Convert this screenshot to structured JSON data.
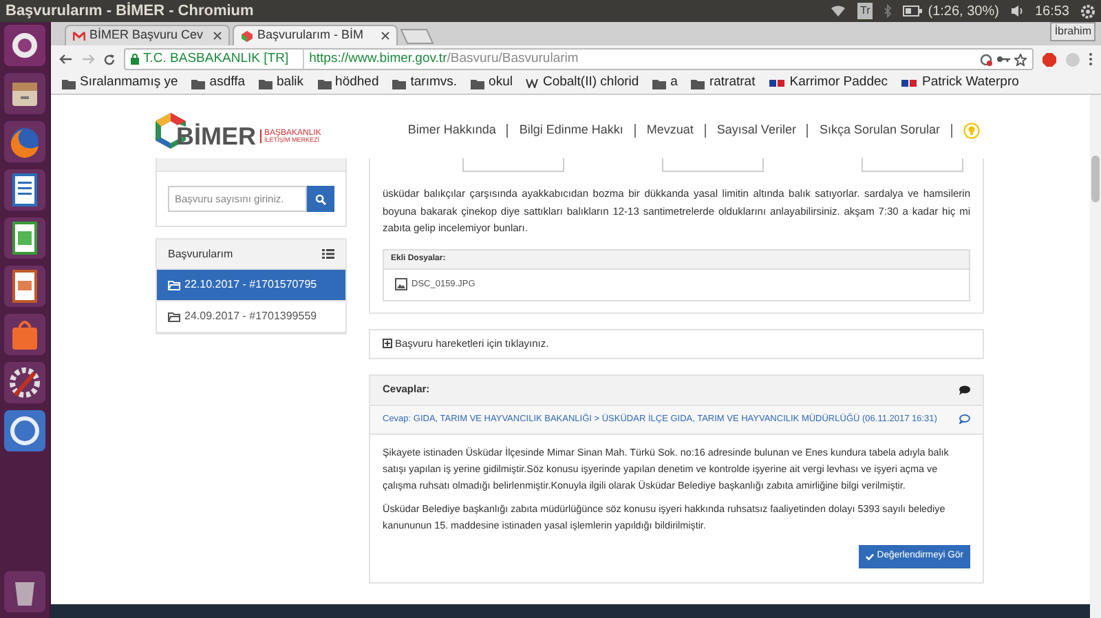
{
  "topbar": {
    "title": "Başvurularım - BİMER - Chromium",
    "keyboard": "Tr",
    "battery": "(1:26, 30%)",
    "clock": "16:53"
  },
  "tabs": [
    {
      "label": "BİMER Başvuru Cev",
      "selected": false,
      "kind": "mail"
    },
    {
      "label": "Başvurularım - BİM",
      "selected": true,
      "kind": "site"
    }
  ],
  "profile": "İbrahim",
  "address": {
    "security": "T.C. BASBAKANLIK [TR]",
    "host": "https://www.bimer.gov.tr",
    "path": "/Basvuru/Basvurularim"
  },
  "bookmarks": [
    {
      "label": "Sıralanmamış ye",
      "kind": "folder"
    },
    {
      "label": "asdffa",
      "kind": "folder"
    },
    {
      "label": "balik",
      "kind": "folder"
    },
    {
      "label": "hödhed",
      "kind": "folder"
    },
    {
      "label": "tarımvs.",
      "kind": "folder"
    },
    {
      "label": "okul",
      "kind": "folder"
    },
    {
      "label": "Cobalt(II) chlorid",
      "kind": "wiki"
    },
    {
      "label": "a",
      "kind": "folder"
    },
    {
      "label": "ratratrat",
      "kind": "folder"
    },
    {
      "label": "Karrimor Paddec",
      "kind": "sd"
    },
    {
      "label": "Patrick Waterpro",
      "kind": "sd"
    }
  ],
  "site": {
    "logo": "BİMER",
    "logo_sub": [
      "BAŞBAKANLIK",
      "İLETİŞİM MERKEZİ"
    ],
    "nav": [
      "Bimer Hakkında",
      "Bilgi Edinme Hakkı",
      "Mevzuat",
      "Sayısal Veriler",
      "Sıkça Sorulan Sorular"
    ]
  },
  "search": {
    "placeholder": "Başvuru sayısını giriniz."
  },
  "applications": {
    "title": "Başvurularım",
    "items": [
      {
        "label": "22.10.2017 - #1701570795",
        "selected": true
      },
      {
        "label": "24.09.2017 - #1701399559",
        "selected": false
      }
    ]
  },
  "complaint": {
    "text": "üsküdar balıkçılar çarşısında ayakkabıcıdan bozma bir dükkanda yasal limitin altında balık satıyorlar. sardalya ve hamsilerin boyuna bakarak çinekop diye sattıkları balıkların 12-13 santimetrelerde olduklarını anlayabilirsiniz. akşam 7:30 a kadar hiç mi zabıta gelip incelemiyor bunları.",
    "attachments_title": "Ekli Dosyalar:",
    "attachments": [
      "DSC_0159.JPG"
    ]
  },
  "history_link": "Başvuru hareketleri için tıklayınız.",
  "answers": {
    "title": "Cevaplar:",
    "answer_title": "Cevap: GIDA, TARIM VE HAYVANCILIK BAKANLIĞI > ÜSKÜDAR İLÇE GIDA, TARIM VE HAYVANCILIK MÜDÜRLÜĞÜ (06.11.2017 16:31)",
    "paragraphs": [
      "Şikayete istinaden Üsküdar İlçesinde Mimar Sinan Mah. Türkü Sok. no:16 adresinde bulunan ve Enes kundura tabela adıyla balık satışı yapılan iş yerine gidilmiştir.Söz konusu işyerinde yapılan denetim ve kontrolde işyerine ait vergi levhası ve işyeri açma ve çalışma ruhsatı olmadığı belirlenmiştir.Konuyla ilgili olarak Üsküdar Belediye başkanlığı zabıta amirliğine bilgi verilmiştir.",
      "Üsküdar Belediye başkanlığı zabıta müdürlüğünce söz konusu işyeri hakkında ruhsatsız faaliyetinden dolayı 5393 sayılı belediye kanununun 15. maddesine istinaden yasal işlemlerin yapıldığı bildirilmiştir."
    ],
    "button": "Değerlendirmeyi Gör"
  }
}
